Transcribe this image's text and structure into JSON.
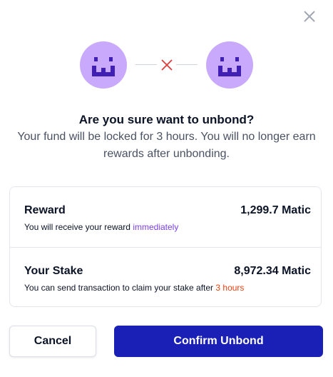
{
  "dialog": {
    "title": "Are you sure want to unbond?",
    "subtitle": "Your fund will be locked for 3 hours. You will no longer earn rewards after unbonding.",
    "icons": {
      "close": "close-icon",
      "avatar_left": "smiley-avatar-icon",
      "avatar_right": "smiley-avatar-icon",
      "disconnect": "cross-icon"
    },
    "colors": {
      "avatar_bg": "#c8a9fb",
      "avatar_face": "#3f1fb4",
      "accent_purple": "#7b3fe4",
      "accent_orange": "#e8410f",
      "confirm_bg": "#1a1fb5",
      "disconnect_x": "#e03a3a"
    }
  },
  "reward": {
    "label": "Reward",
    "value": "1,299.7 Matic",
    "note_prefix": "You will receive your reward",
    "note_highlight": "immediately"
  },
  "stake": {
    "label": "Your Stake",
    "value": "8,972.34 Matic",
    "note_prefix": "You can send transaction to claim your stake after",
    "note_highlight": "3 hours"
  },
  "buttons": {
    "cancel": "Cancel",
    "confirm": "Confirm Unbond"
  }
}
